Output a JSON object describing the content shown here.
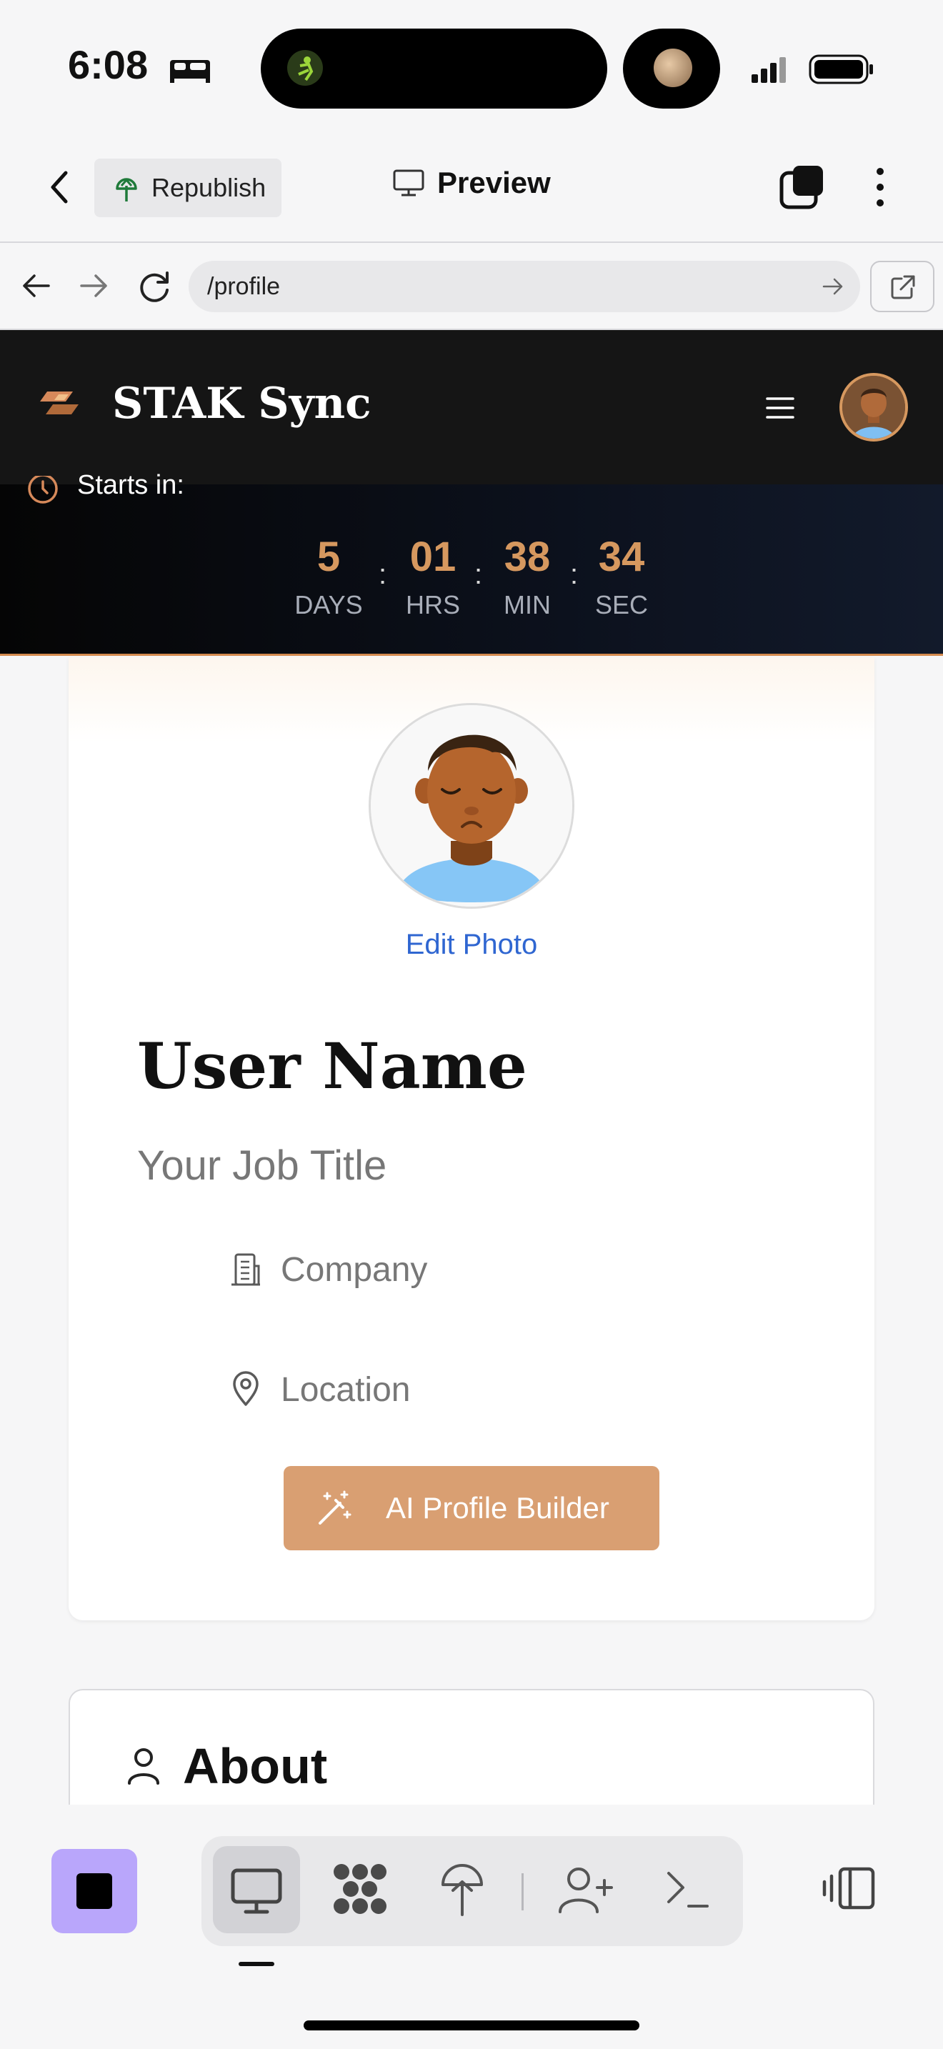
{
  "status_bar": {
    "time": "6:08"
  },
  "top_bar": {
    "republish_label": "Republish",
    "preview_label": "Preview"
  },
  "url_bar": {
    "path": "/profile"
  },
  "app_header": {
    "brand": "STAK Sync"
  },
  "countdown": {
    "label": "Starts in:",
    "units": [
      {
        "value": "5",
        "label": "DAYS"
      },
      {
        "value": "01",
        "label": "HRS"
      },
      {
        "value": "38",
        "label": "MIN"
      },
      {
        "value": "34",
        "label": "SEC"
      }
    ],
    "separator": ":"
  },
  "profile": {
    "edit_photo_label": "Edit Photo",
    "user_name": "User Name",
    "job_title": "Your Job Title",
    "company": "Company",
    "location": "Location",
    "ai_button_label": "AI Profile Builder"
  },
  "about": {
    "title": "About"
  },
  "colors": {
    "accent": "#d99f72",
    "accent_text": "#d6985f",
    "link": "#2f66d1",
    "header_bg": "#151515",
    "stop_button": "#b9a6fb"
  },
  "icons": {
    "back": "chevron-left-icon",
    "republish": "globe-tree-icon",
    "preview": "monitor-icon",
    "tabs": "tabs-icon",
    "more": "more-vertical-icon",
    "nav_back": "arrow-left-icon",
    "nav_forward": "arrow-right-icon",
    "reload": "reload-icon",
    "url_go": "arrow-right-icon",
    "open_external": "external-link-icon",
    "logo": "stak-logo-icon",
    "menu": "hamburger-menu-icon",
    "clock": "clock-icon",
    "company": "building-icon",
    "location": "map-pin-icon",
    "ai": "magic-wand-icon",
    "about": "user-icon",
    "toolbar": [
      "monitor-icon",
      "replit-grid-icon",
      "deploy-icon",
      "add-user-icon",
      "terminal-icon"
    ],
    "layout": "panel-layout-icon"
  }
}
